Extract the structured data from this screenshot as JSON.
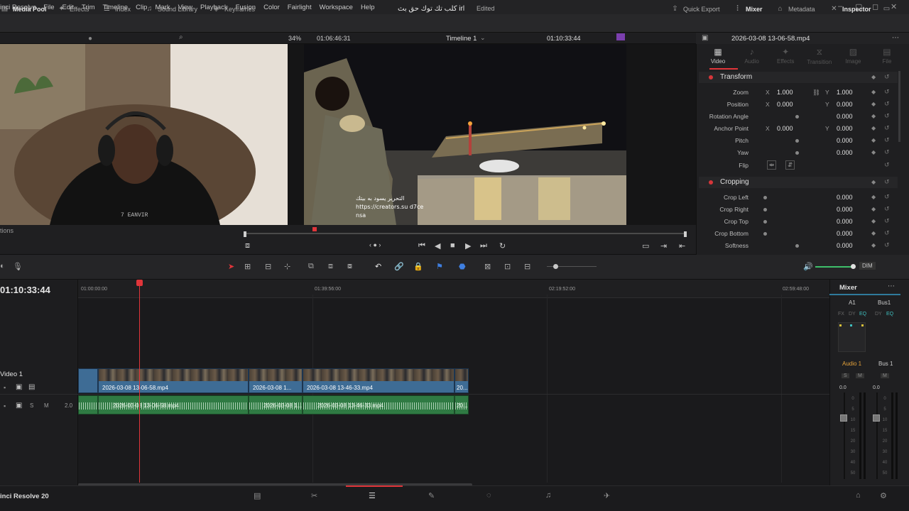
{
  "menu": {
    "app": "inci Resolve",
    "items": [
      "File",
      "Edit",
      "Trim",
      "Timeline",
      "Clip",
      "Mark",
      "View",
      "Playback",
      "Fusion",
      "Color",
      "Fairlight",
      "Workspace",
      "Help"
    ]
  },
  "toolbar": {
    "media_pool": "Media Pool",
    "effects": "Effects",
    "index": "Index",
    "sound_library": "Sound Library",
    "keyframes": "Keyframes",
    "project_title": "كلب تك توك حق بث irl",
    "project_status": "Edited",
    "quick_export": "Quick Export",
    "mixer": "Mixer",
    "metadata": "Metadata",
    "inspector": "Inspector"
  },
  "viewer": {
    "zoom": "34%",
    "source_timecode": "01:06:46:31",
    "timeline_name": "Timeline 1",
    "record_timecode": "01:10:33:44",
    "clip_name": "2026-03-08 13-06-58.mp4",
    "subtitle_line1": "التحرير يسود به بيتك",
    "subtitle_line2": "https://creators.su d7ce",
    "subtitle_line3": "nsa",
    "left_panel_label": "tions"
  },
  "inspector": {
    "tabs": [
      {
        "label": "Video",
        "icon": "video-icon",
        "active": true
      },
      {
        "label": "Audio",
        "icon": "audio-icon",
        "active": false
      },
      {
        "label": "Effects",
        "icon": "effects-icon",
        "active": false
      },
      {
        "label": "Transition",
        "icon": "transition-icon",
        "active": false
      },
      {
        "label": "Image",
        "icon": "image-icon",
        "active": false
      },
      {
        "label": "File",
        "icon": "file-icon",
        "active": false
      }
    ],
    "transform": {
      "title": "Transform",
      "zoom": {
        "label": "Zoom",
        "x": "1.000",
        "y": "1.000"
      },
      "position": {
        "label": "Position",
        "x": "0.000",
        "y": "0.000"
      },
      "rotation": {
        "label": "Rotation Angle",
        "value": "0.000"
      },
      "anchor": {
        "label": "Anchor Point",
        "x": "0.000",
        "y": "0.000"
      },
      "pitch": {
        "label": "Pitch",
        "value": "0.000"
      },
      "yaw": {
        "label": "Yaw",
        "value": "0.000"
      },
      "flip": {
        "label": "Flip"
      }
    },
    "cropping": {
      "title": "Cropping",
      "crop_left": {
        "label": "Crop Left",
        "value": "0.000"
      },
      "crop_right": {
        "label": "Crop Right",
        "value": "0.000"
      },
      "crop_top": {
        "label": "Crop Top",
        "value": "0.000"
      },
      "crop_bottom": {
        "label": "Crop Bottom",
        "value": "0.000"
      },
      "softness": {
        "label": "Softness",
        "value": "0.000"
      }
    },
    "axis_x": "X",
    "axis_y": "Y"
  },
  "edit_toolbar": {
    "dim": "DIM"
  },
  "timeline": {
    "timecode": "01:10:33:44",
    "ruler": [
      "01:00:00:00",
      "01:39:56:00",
      "02:19:52:00",
      "02:59:48:00"
    ],
    "track_video": "Video 1",
    "audio_level": "2.0",
    "solo": "S",
    "mute": "M",
    "video_clips": [
      "2026-03-08 13-06-58.mp4",
      "2026-03-08 1...",
      "2026-03-08 13-46-33.mp4",
      "20..."
    ],
    "audio_clips": [
      "2026-03-08 13-06-58.mp4",
      "2026-03-08 1...",
      "2026-03-08 13-46-33.mp4",
      "20..."
    ]
  },
  "mixer": {
    "title": "Mixer",
    "channel_a1": "A1",
    "channel_bus1": "Bus1",
    "fx_labels": [
      "FX",
      "DY",
      "EQ"
    ],
    "strip_audio1": "Audio 1",
    "strip_bus1": "Bus 1",
    "solo": "S",
    "mute": "M",
    "gain_audio1": "0.0",
    "gain_bus1": "0.0",
    "scale": [
      "0",
      "5",
      "10",
      "15",
      "20",
      "30",
      "40",
      "50"
    ]
  },
  "footer": {
    "app_version": "inci Resolve 20",
    "pages": [
      "media-page-icon",
      "cut-page-icon",
      "edit-page-icon",
      "fusion-page-icon",
      "color-page-icon",
      "fairlight-page-icon",
      "deliver-page-icon"
    ],
    "active_page": 2
  },
  "colors": {
    "accent_red": "#e0353a",
    "video_clip": "#3e6c95",
    "audio_clip": "#2f7a43",
    "meter_green": "#3fbf6a"
  }
}
